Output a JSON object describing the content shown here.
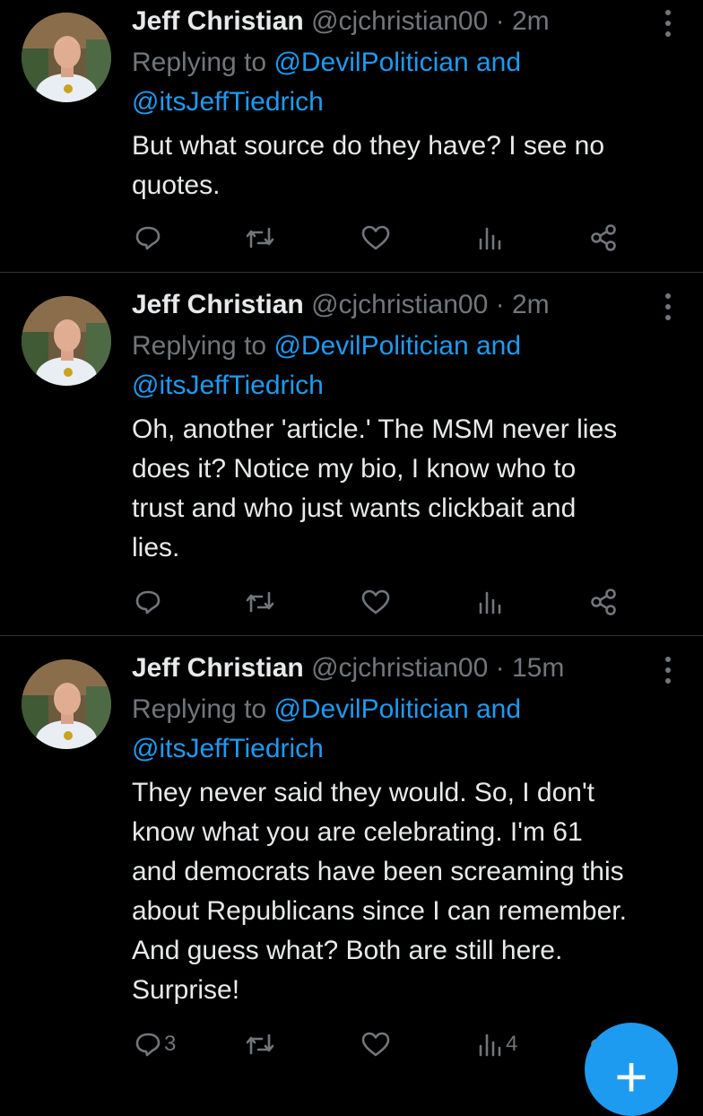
{
  "colors": {
    "background": "#000000",
    "text": "#e7e9ea",
    "muted": "#71767b",
    "accent": "#1d9bf0",
    "divider": "#2f3336"
  },
  "tweets": [
    {
      "name": "Jeff Christian",
      "handle": "@cjchristian00",
      "separator": "·",
      "time": "2m",
      "replying_prefix": "Replying to ",
      "mention1": "@DevilPolitician",
      "mention_joiner": " and ",
      "mention2": "@itsJeffTiedrich",
      "text": "But what source do they have? I see no\nquotes.",
      "reply_count": "",
      "retweet_count": "",
      "like_count": "",
      "views_count": ""
    },
    {
      "name": "Jeff Christian",
      "handle": "@cjchristian00",
      "separator": "·",
      "time": "2m",
      "replying_prefix": "Replying to ",
      "mention1": "@DevilPolitician",
      "mention_joiner": " and ",
      "mention2": "@itsJeffTiedrich",
      "text": "Oh, another 'article.' The MSM never lies\ndoes it? Notice my bio, I know who to\ntrust and who just wants clickbait and\nlies.",
      "reply_count": "",
      "retweet_count": "",
      "like_count": "",
      "views_count": ""
    },
    {
      "name": "Jeff Christian",
      "handle": "@cjchristian00",
      "separator": "·",
      "time": "15m",
      "replying_prefix": "Replying to ",
      "mention1": "@DevilPolitician",
      "mention_joiner": " and ",
      "mention2": "@itsJeffTiedrich",
      "text": "They never said they would. So, I don't\nknow what you are celebrating. I'm 61\nand democrats have been screaming this\nabout Republicans since I can remember.\nAnd guess what? Both are still here.\nSurprise!",
      "reply_count": "3",
      "retweet_count": "",
      "like_count": "",
      "views_count": "4"
    }
  ],
  "icons": {
    "reply": "reply-icon",
    "retweet": "retweet-icon",
    "like": "heart-icon",
    "views": "views-icon",
    "share": "share-icon",
    "more": "more-icon",
    "compose": "compose-plus-icon"
  },
  "fab": {
    "label": "+"
  }
}
